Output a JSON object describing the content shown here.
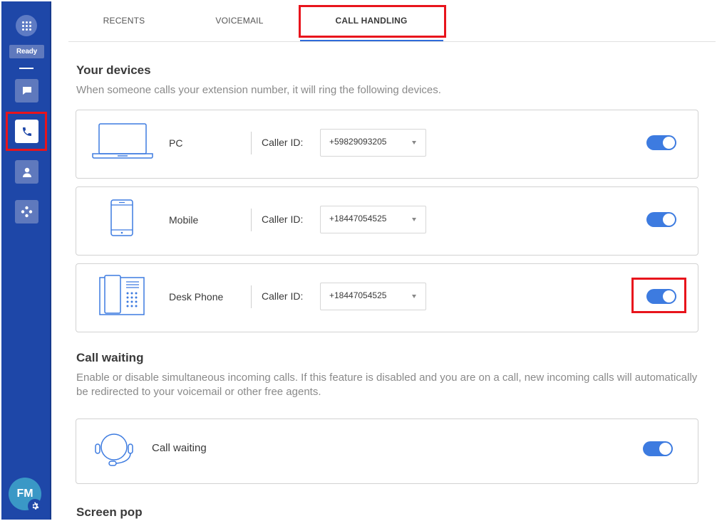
{
  "sidebar": {
    "status": "Ready",
    "avatar_initials": "FM",
    "icons": [
      "dialpad-icon",
      "chat-icon",
      "phone-icon",
      "contacts-icon",
      "apps-icon",
      "gear-icon"
    ]
  },
  "tabs": [
    {
      "label": "RECENTS"
    },
    {
      "label": "VOICEMAIL"
    },
    {
      "label": "CALL HANDLING",
      "active": true
    }
  ],
  "devices_section": {
    "title": "Your devices",
    "description": "When someone calls your extension number, it will ring the following devices.",
    "caller_id_label": "Caller ID:",
    "devices": [
      {
        "name": "PC",
        "icon": "laptop-icon",
        "caller_id": "+59829093205",
        "enabled": true
      },
      {
        "name": "Mobile",
        "icon": "mobile-phone-icon",
        "caller_id": "+18447054525",
        "enabled": true
      },
      {
        "name": "Desk Phone",
        "icon": "desk-phone-icon",
        "caller_id": "+18447054525",
        "enabled": true
      }
    ]
  },
  "call_waiting_section": {
    "title": "Call waiting",
    "description": "Enable or disable simultaneous incoming calls. If this feature is disabled and you are on a call, new incoming calls will automatically be redirected to your voicemail or other free agents.",
    "item_label": "Call waiting",
    "icon": "headset-icon",
    "enabled": true
  },
  "screen_pop_section": {
    "title": "Screen pop"
  },
  "colors": {
    "sidebar": "#1e47a8",
    "accent": "#3d7be0",
    "highlight": "#e8141c"
  }
}
